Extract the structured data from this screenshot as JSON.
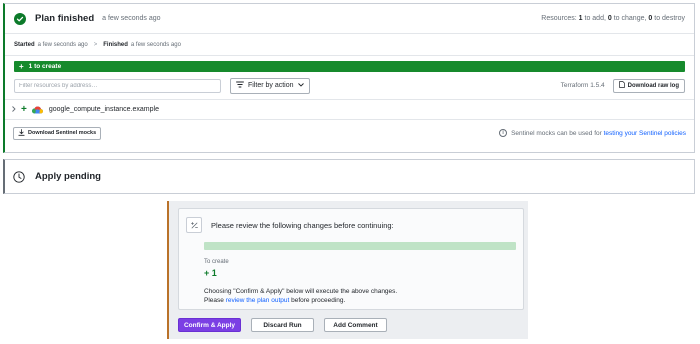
{
  "plan": {
    "title": "Plan finished",
    "time": "a few seconds ago",
    "resources": {
      "label": "Resources:",
      "to_add": "1",
      "to_add_label": "to add,",
      "to_change": "0",
      "to_change_label": "to change,",
      "to_destroy": "0",
      "to_destroy_label": "to destroy"
    },
    "timeline": {
      "started_label": "Started",
      "started_time": "a few seconds ago",
      "separator": ">",
      "finished_label": "Finished",
      "finished_time": "a few seconds ago"
    },
    "create_bar": {
      "icon": "+",
      "label": "1 to create"
    },
    "filter": {
      "placeholder": "Filter resources by address…",
      "action_label": "Filter by action",
      "terraform_version": "Terraform 1.5.4",
      "raw_log_label": "Download raw log"
    },
    "resource": {
      "action": "+",
      "address": "google_compute_instance.example",
      "provider_icon": "google-cloud-icon"
    },
    "sentinel": {
      "mocks_label": "Download Sentinel mocks",
      "note_text": "Sentinel mocks can be used for",
      "note_link": "testing your Sentinel policies"
    }
  },
  "apply": {
    "title": "Apply pending"
  },
  "confirm": {
    "review_title": "Please review the following changes before continuing:",
    "create_fraction": 1.0,
    "to_create_label": "To create",
    "to_create_count": "+ 1",
    "line1": "Choosing \"Confirm & Apply\" below will execute the above changes.",
    "line2_prefix": "Please",
    "line2_link": "review the plan output",
    "line2_suffix": "before proceeding.",
    "buttons": {
      "confirm": "Confirm & Apply",
      "discard": "Discard Run",
      "comment": "Add Comment"
    }
  },
  "colors": {
    "success": "#0c7a2a",
    "create_bar": "#168a2c",
    "primary": "#7b3fe4",
    "link": "#1060ff",
    "pending_accent": "#b9722a"
  }
}
